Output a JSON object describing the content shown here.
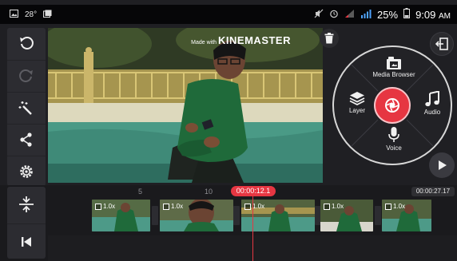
{
  "status_bar": {
    "temperature": "28°",
    "battery_percent": "25%",
    "time": "9:09",
    "time_suffix": "AM"
  },
  "tools": [
    {
      "name": "undo",
      "icon": "undo-icon"
    },
    {
      "name": "redo",
      "icon": "redo-icon"
    },
    {
      "name": "effects",
      "icon": "magic-wand-icon"
    },
    {
      "name": "share",
      "icon": "share-icon"
    },
    {
      "name": "settings",
      "icon": "gear-icon"
    }
  ],
  "preview": {
    "watermark_small": "Made with",
    "watermark_brand": "KINEMASTER"
  },
  "radial_menu": {
    "media_label": "Media Browser",
    "layer_label": "Layer",
    "audio_label": "Audio",
    "voice_label": "Voice"
  },
  "timeline": {
    "ruler_labels": [
      "5",
      "10"
    ],
    "current_time": "00:00:12.1",
    "end_time": "00:00:27.17",
    "clips": [
      {
        "badge": "1.0x"
      },
      {
        "badge": "1.0x"
      },
      {
        "badge": "1.0x"
      },
      {
        "badge": "1.0x"
      },
      {
        "badge": "1.0x"
      }
    ]
  },
  "colors": {
    "accent_red": "#e63642",
    "panel": "#2c2c31",
    "background": "#1f1f23"
  }
}
